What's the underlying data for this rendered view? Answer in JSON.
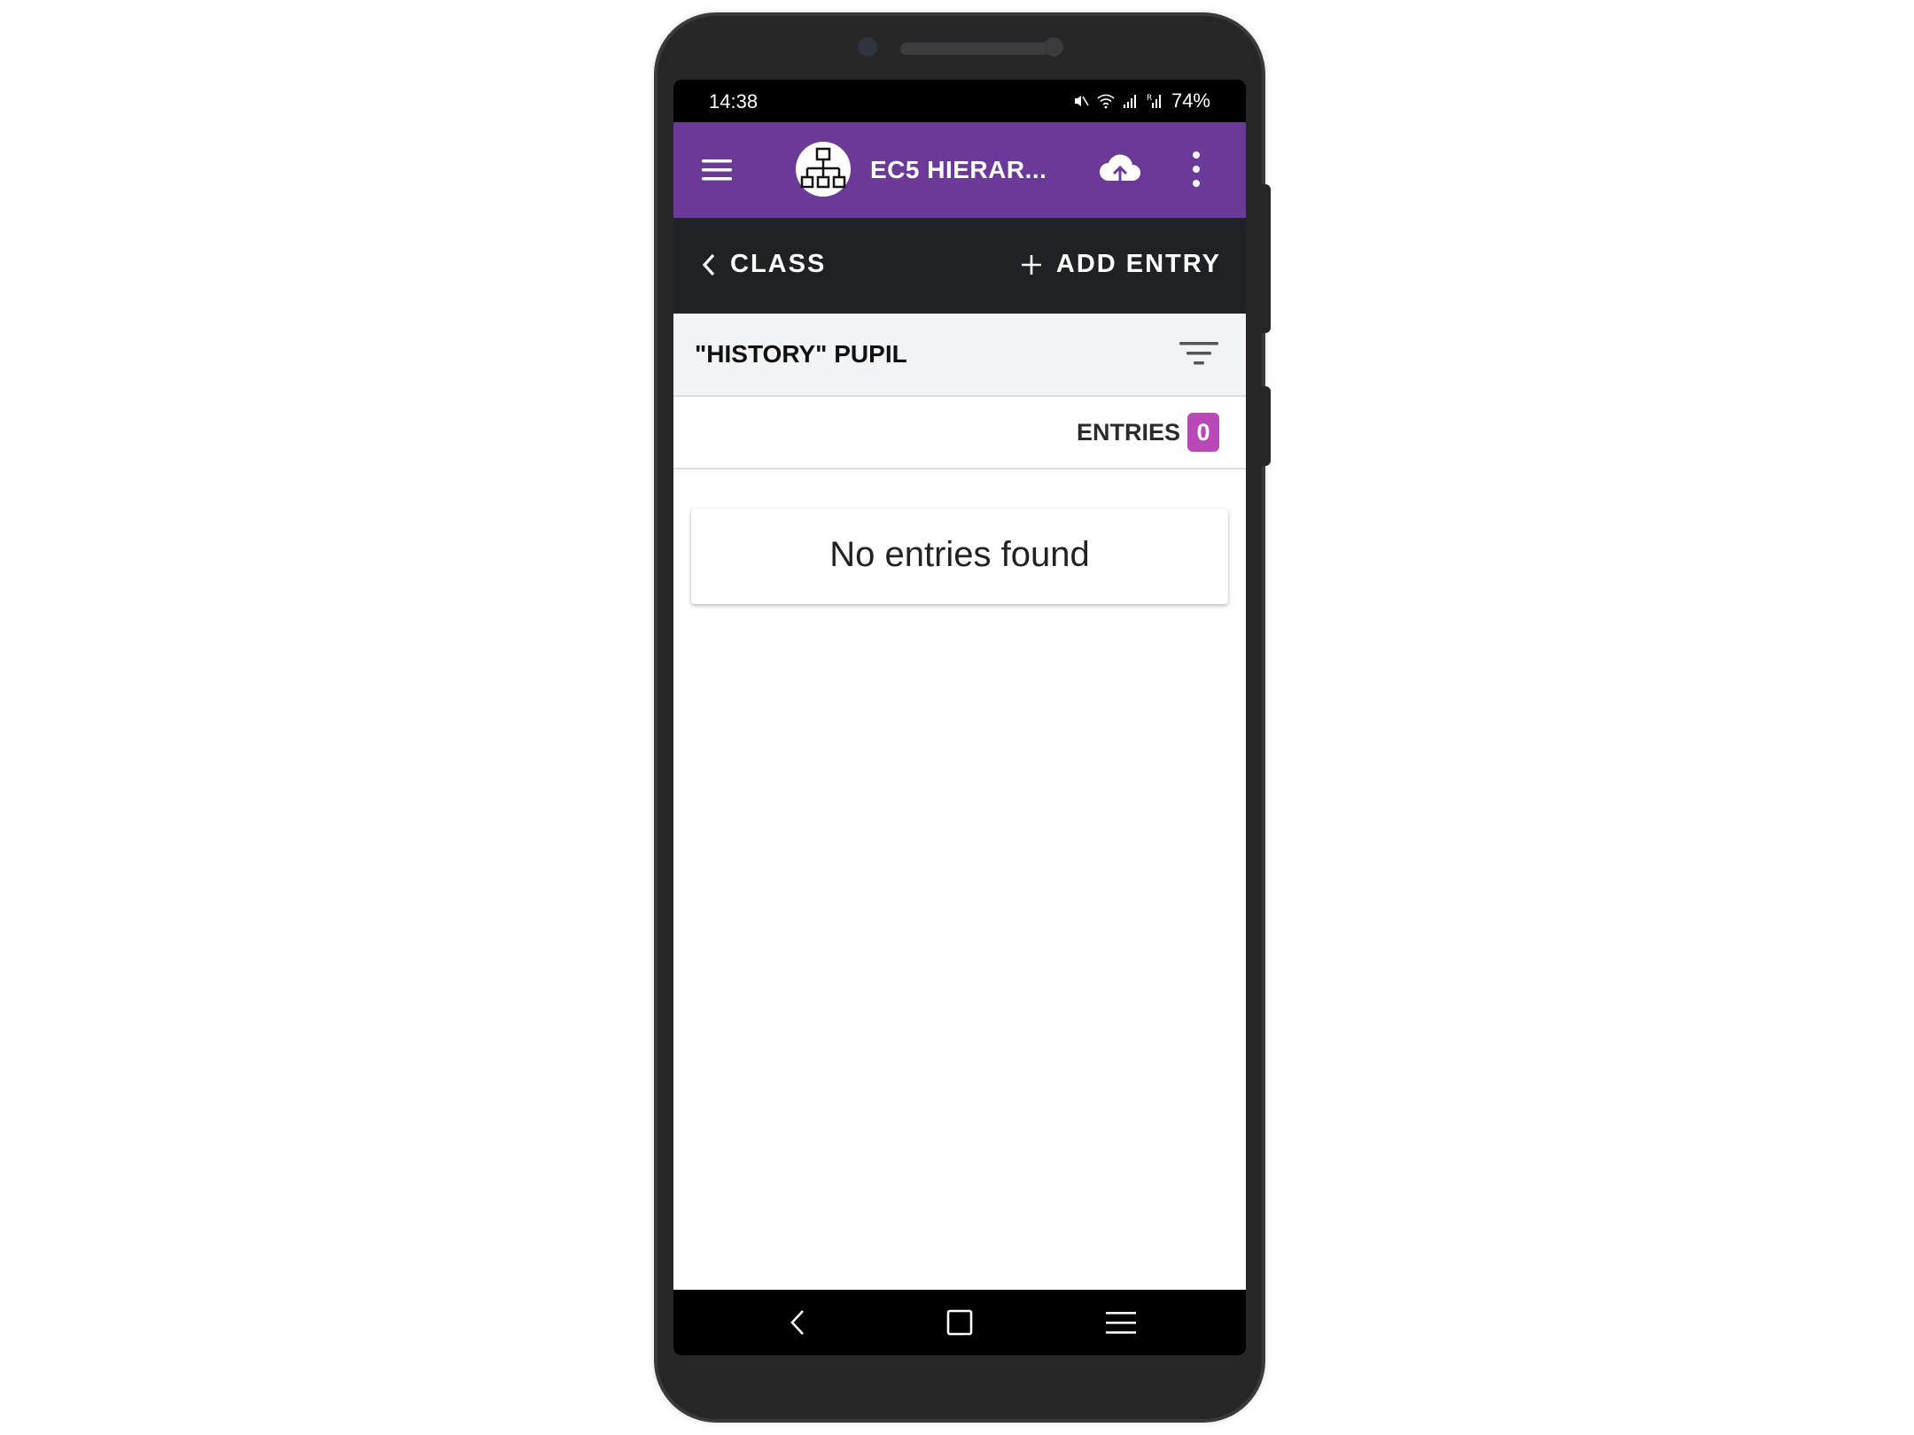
{
  "status_bar": {
    "time": "14:38",
    "battery": "74%",
    "icons": [
      "mute-icon",
      "wifi-icon",
      "signal-icon",
      "signal-r-icon"
    ]
  },
  "app_bar": {
    "title": "EC5 HIERAR...",
    "color": "#6a3a96",
    "icons": [
      "menu-icon",
      "project-logo-icon",
      "cloud-upload-icon",
      "more-vert-icon"
    ]
  },
  "sub_nav": {
    "back_label": "CLASS",
    "add_label": "ADD ENTRY"
  },
  "form": {
    "title": "\"HISTORY\" PUPIL"
  },
  "entries": {
    "label": "ENTRIES",
    "count": "0",
    "badge_color": "#bb48b7"
  },
  "empty_state": {
    "message": "No entries found"
  },
  "nav_bar": {
    "icons": [
      "nav-back-icon",
      "nav-home-icon",
      "nav-recents-icon"
    ]
  }
}
